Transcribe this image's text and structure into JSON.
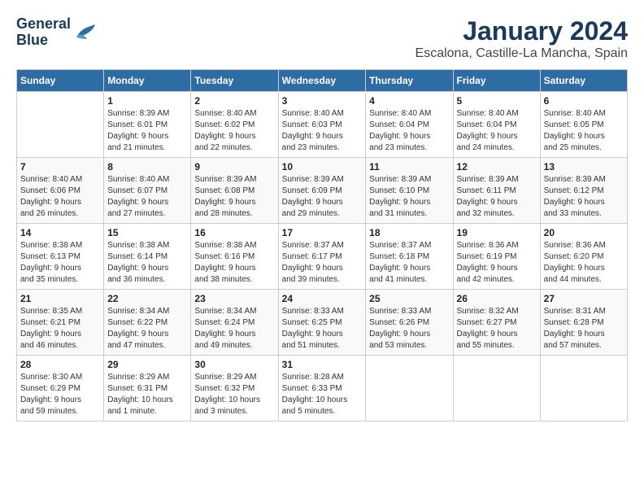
{
  "logo": {
    "line1": "General",
    "line2": "Blue"
  },
  "title": "January 2024",
  "subtitle": "Escalona, Castille-La Mancha, Spain",
  "days_of_week": [
    "Sunday",
    "Monday",
    "Tuesday",
    "Wednesday",
    "Thursday",
    "Friday",
    "Saturday"
  ],
  "weeks": [
    [
      {
        "day": "",
        "info": ""
      },
      {
        "day": "1",
        "info": "Sunrise: 8:39 AM\nSunset: 6:01 PM\nDaylight: 9 hours\nand 21 minutes."
      },
      {
        "day": "2",
        "info": "Sunrise: 8:40 AM\nSunset: 6:02 PM\nDaylight: 9 hours\nand 22 minutes."
      },
      {
        "day": "3",
        "info": "Sunrise: 8:40 AM\nSunset: 6:03 PM\nDaylight: 9 hours\nand 23 minutes."
      },
      {
        "day": "4",
        "info": "Sunrise: 8:40 AM\nSunset: 6:04 PM\nDaylight: 9 hours\nand 23 minutes."
      },
      {
        "day": "5",
        "info": "Sunrise: 8:40 AM\nSunset: 6:04 PM\nDaylight: 9 hours\nand 24 minutes."
      },
      {
        "day": "6",
        "info": "Sunrise: 8:40 AM\nSunset: 6:05 PM\nDaylight: 9 hours\nand 25 minutes."
      }
    ],
    [
      {
        "day": "7",
        "info": "Sunrise: 8:40 AM\nSunset: 6:06 PM\nDaylight: 9 hours\nand 26 minutes."
      },
      {
        "day": "8",
        "info": "Sunrise: 8:40 AM\nSunset: 6:07 PM\nDaylight: 9 hours\nand 27 minutes."
      },
      {
        "day": "9",
        "info": "Sunrise: 8:39 AM\nSunset: 6:08 PM\nDaylight: 9 hours\nand 28 minutes."
      },
      {
        "day": "10",
        "info": "Sunrise: 8:39 AM\nSunset: 6:09 PM\nDaylight: 9 hours\nand 29 minutes."
      },
      {
        "day": "11",
        "info": "Sunrise: 8:39 AM\nSunset: 6:10 PM\nDaylight: 9 hours\nand 31 minutes."
      },
      {
        "day": "12",
        "info": "Sunrise: 8:39 AM\nSunset: 6:11 PM\nDaylight: 9 hours\nand 32 minutes."
      },
      {
        "day": "13",
        "info": "Sunrise: 8:39 AM\nSunset: 6:12 PM\nDaylight: 9 hours\nand 33 minutes."
      }
    ],
    [
      {
        "day": "14",
        "info": "Sunrise: 8:38 AM\nSunset: 6:13 PM\nDaylight: 9 hours\nand 35 minutes."
      },
      {
        "day": "15",
        "info": "Sunrise: 8:38 AM\nSunset: 6:14 PM\nDaylight: 9 hours\nand 36 minutes."
      },
      {
        "day": "16",
        "info": "Sunrise: 8:38 AM\nSunset: 6:16 PM\nDaylight: 9 hours\nand 38 minutes."
      },
      {
        "day": "17",
        "info": "Sunrise: 8:37 AM\nSunset: 6:17 PM\nDaylight: 9 hours\nand 39 minutes."
      },
      {
        "day": "18",
        "info": "Sunrise: 8:37 AM\nSunset: 6:18 PM\nDaylight: 9 hours\nand 41 minutes."
      },
      {
        "day": "19",
        "info": "Sunrise: 8:36 AM\nSunset: 6:19 PM\nDaylight: 9 hours\nand 42 minutes."
      },
      {
        "day": "20",
        "info": "Sunrise: 8:36 AM\nSunset: 6:20 PM\nDaylight: 9 hours\nand 44 minutes."
      }
    ],
    [
      {
        "day": "21",
        "info": "Sunrise: 8:35 AM\nSunset: 6:21 PM\nDaylight: 9 hours\nand 46 minutes."
      },
      {
        "day": "22",
        "info": "Sunrise: 8:34 AM\nSunset: 6:22 PM\nDaylight: 9 hours\nand 47 minutes."
      },
      {
        "day": "23",
        "info": "Sunrise: 8:34 AM\nSunset: 6:24 PM\nDaylight: 9 hours\nand 49 minutes."
      },
      {
        "day": "24",
        "info": "Sunrise: 8:33 AM\nSunset: 6:25 PM\nDaylight: 9 hours\nand 51 minutes."
      },
      {
        "day": "25",
        "info": "Sunrise: 8:33 AM\nSunset: 6:26 PM\nDaylight: 9 hours\nand 53 minutes."
      },
      {
        "day": "26",
        "info": "Sunrise: 8:32 AM\nSunset: 6:27 PM\nDaylight: 9 hours\nand 55 minutes."
      },
      {
        "day": "27",
        "info": "Sunrise: 8:31 AM\nSunset: 6:28 PM\nDaylight: 9 hours\nand 57 minutes."
      }
    ],
    [
      {
        "day": "28",
        "info": "Sunrise: 8:30 AM\nSunset: 6:29 PM\nDaylight: 9 hours\nand 59 minutes."
      },
      {
        "day": "29",
        "info": "Sunrise: 8:29 AM\nSunset: 6:31 PM\nDaylight: 10 hours\nand 1 minute."
      },
      {
        "day": "30",
        "info": "Sunrise: 8:29 AM\nSunset: 6:32 PM\nDaylight: 10 hours\nand 3 minutes."
      },
      {
        "day": "31",
        "info": "Sunrise: 8:28 AM\nSunset: 6:33 PM\nDaylight: 10 hours\nand 5 minutes."
      },
      {
        "day": "",
        "info": ""
      },
      {
        "day": "",
        "info": ""
      },
      {
        "day": "",
        "info": ""
      }
    ]
  ]
}
